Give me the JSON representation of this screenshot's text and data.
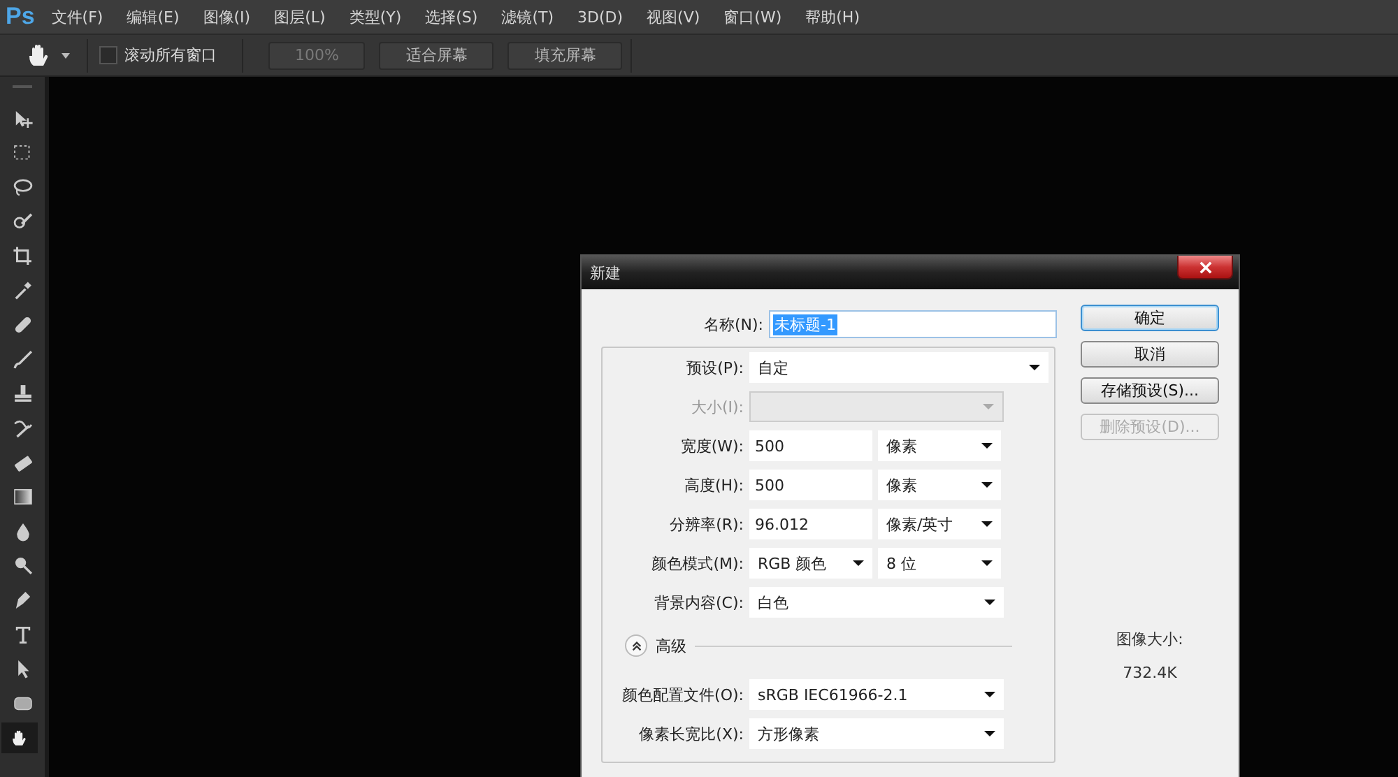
{
  "app": {
    "logo": "Ps"
  },
  "menu": [
    "文件(F)",
    "编辑(E)",
    "图像(I)",
    "图层(L)",
    "类型(Y)",
    "选择(S)",
    "滤镜(T)",
    "3D(D)",
    "视图(V)",
    "窗口(W)",
    "帮助(H)"
  ],
  "options_bar": {
    "scroll_all": {
      "label": "滚动所有窗口",
      "checked": false
    },
    "buttons": [
      {
        "label": "100%",
        "disabled": true
      },
      {
        "label": "适合屏幕",
        "disabled": false
      },
      {
        "label": "填充屏幕",
        "disabled": false
      }
    ]
  },
  "tools": [
    {
      "kind": "move",
      "selected": false
    },
    {
      "kind": "marquee",
      "selected": false
    },
    {
      "kind": "lasso",
      "selected": false
    },
    {
      "kind": "quick_select",
      "selected": false
    },
    {
      "kind": "crop",
      "selected": false
    },
    {
      "kind": "eyedropper",
      "selected": false
    },
    {
      "kind": "healing",
      "selected": false
    },
    {
      "kind": "brush",
      "selected": false
    },
    {
      "kind": "stamp",
      "selected": false
    },
    {
      "kind": "history",
      "selected": false
    },
    {
      "kind": "eraser",
      "selected": false
    },
    {
      "kind": "gradient",
      "selected": false
    },
    {
      "kind": "blur",
      "selected": false
    },
    {
      "kind": "dodge",
      "selected": false
    },
    {
      "kind": "pen",
      "selected": false
    },
    {
      "kind": "type",
      "selected": false
    },
    {
      "kind": "path_select",
      "selected": false
    },
    {
      "kind": "shape",
      "selected": false
    },
    {
      "kind": "hand",
      "selected": true
    }
  ],
  "dialog": {
    "title": "新建",
    "name": {
      "label": "名称(N):",
      "value": "未标题-1",
      "selected": true
    },
    "preset": {
      "label": "预设(P):",
      "value": "自定"
    },
    "rows": [
      {
        "kind": "select",
        "label": "大小(I):",
        "disabled": true
      },
      {
        "kind": "input_unit",
        "label": "宽度(W):",
        "value": "500",
        "unit": "像素",
        "disabled": false
      },
      {
        "kind": "input_unit",
        "label": "高度(H):",
        "value": "500",
        "unit": "像素",
        "disabled": false
      },
      {
        "kind": "input_unit",
        "label": "分辨率(R):",
        "value": "96.012",
        "unit": "像素/英寸",
        "disabled": false
      },
      {
        "kind": "select_pair",
        "label": "颜色模式(M):",
        "value": "RGB 颜色",
        "unit": "8 位",
        "disabled": false
      },
      {
        "kind": "select",
        "label": "背景内容(C):",
        "value": "白色",
        "disabled": false
      }
    ],
    "advanced": {
      "label": "高级",
      "expanded": true
    },
    "advanced_rows": [
      {
        "label": "颜色配置文件(O):",
        "value": "sRGB IEC61966-2.1"
      },
      {
        "label": "像素长宽比(X):",
        "value": "方形像素"
      }
    ],
    "buttons": [
      {
        "label": "确定",
        "default": true,
        "disabled": false
      },
      {
        "label": "取消",
        "default": false,
        "disabled": false
      },
      {
        "label": "存储预设(S)...",
        "default": false,
        "disabled": false
      },
      {
        "label": "删除预设(D)...",
        "default": false,
        "disabled": true
      }
    ],
    "image_size": {
      "label": "图像大小:",
      "value": "732.4K"
    }
  }
}
